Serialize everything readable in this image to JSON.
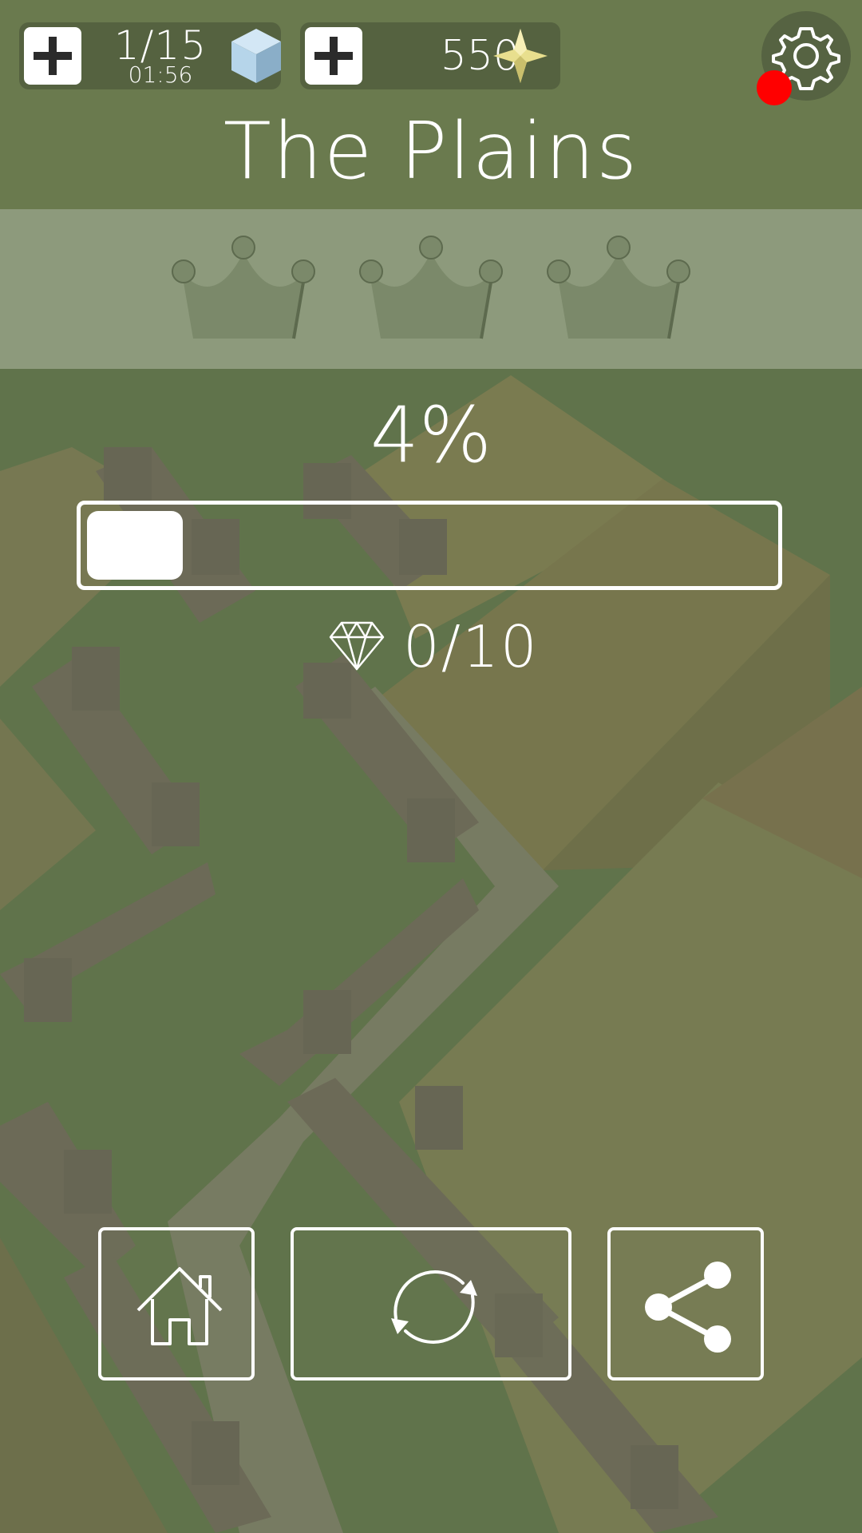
{
  "hud": {
    "energy": {
      "count": "1/15",
      "timer": "01:56",
      "icon": "cube-icon"
    },
    "coins": {
      "value": "550",
      "icon": "star-icon"
    },
    "settings_icon": "gear-icon",
    "notification": true
  },
  "level": {
    "title": "The Plains",
    "crowns_total": 3,
    "crowns_earned": 0
  },
  "progress": {
    "percent_label": "4%",
    "fraction": 0.04
  },
  "gems": {
    "label": "0/10",
    "icon": "diamond-icon"
  },
  "buttons": {
    "home": "home-icon",
    "restart": "restart-icon",
    "share": "share-icon"
  },
  "colors": {
    "header": "#6a7a4e",
    "crown_band": "#8d9a7c",
    "crown": "#7c8a6a",
    "grass": "#5a6e46",
    "notification": "#ff0000",
    "cube": "#b6d5ea",
    "star": "#e8df8e"
  }
}
